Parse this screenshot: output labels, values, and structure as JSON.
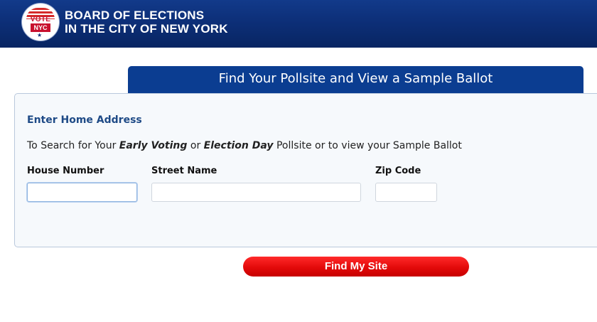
{
  "header": {
    "logo": {
      "vote_text": "VOTE",
      "nyc_text": "NYC",
      "icon": "vote-nyc-seal"
    },
    "title_line1": "BOARD OF ELECTIONS",
    "title_line2": "IN THE CITY OF NEW YORK"
  },
  "tab": {
    "title": "Find Your Pollsite and View a Sample Ballot"
  },
  "form": {
    "heading": "Enter Home Address",
    "instructions": {
      "prefix": "To Search for Your ",
      "early_voting": "Early Voting",
      "or": " or ",
      "election_day": "Election Day",
      "suffix": " Pollsite or to view your Sample Ballot"
    },
    "house_number": {
      "label": "House Number",
      "value": "",
      "placeholder": ""
    },
    "street_name": {
      "label": "Street Name",
      "value": "",
      "placeholder": ""
    },
    "zip_code": {
      "label": "Zip Code",
      "value": "",
      "placeholder": ""
    },
    "submit_label": "Find My Site"
  },
  "colors": {
    "header_blue": "#0d2f78",
    "tab_blue": "#0b3d91",
    "heading_blue": "#1e4a86",
    "button_red": "#e30a0a"
  }
}
